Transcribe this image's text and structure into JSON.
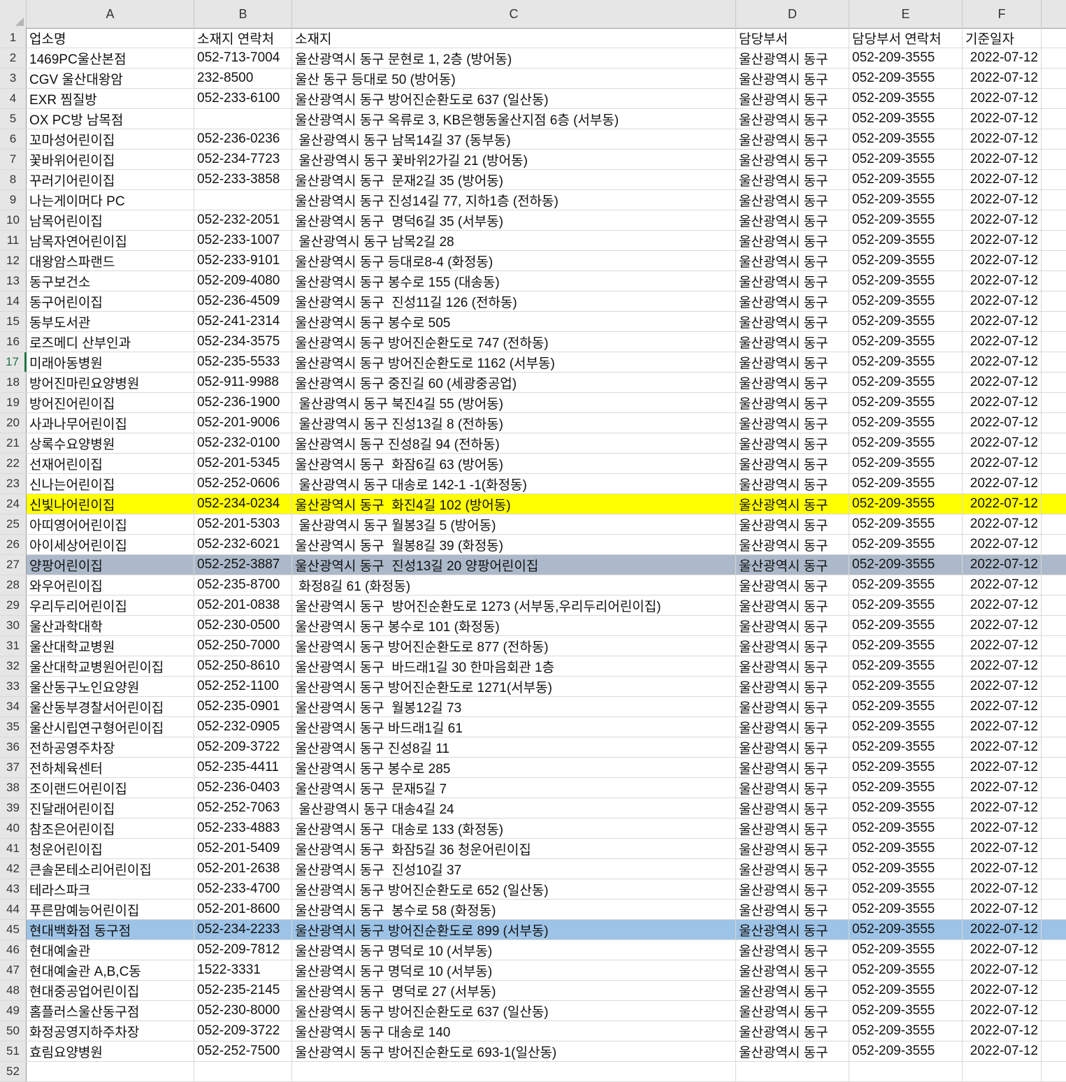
{
  "columns": [
    "A",
    "B",
    "C",
    "D",
    "E",
    "F"
  ],
  "header": {
    "a": "업소명",
    "b": "소재지 연락처",
    "c": "소재지",
    "d": "담당부서",
    "e": "담당부서 연락처",
    "f": "기준일자"
  },
  "rows": [
    {
      "n": "2",
      "a": "1469PC울산본점",
      "b": "052-713-7004",
      "c": "울산광역시 동구 문현로 1, 2층 (방어동)",
      "d": "울산광역시 동구",
      "e": "052-209-3555",
      "f": "2022-07-12"
    },
    {
      "n": "3",
      "a": "CGV 울산대왕암",
      "b": "232-8500",
      "c": "울산 동구 등대로 50 (방어동)",
      "d": "울산광역시 동구",
      "e": "052-209-3555",
      "f": "2022-07-12"
    },
    {
      "n": "4",
      "a": "EXR 찜질방",
      "b": "052-233-6100",
      "c": "울산광역시 동구 방어진순환도로 637 (일산동)",
      "d": "울산광역시 동구",
      "e": "052-209-3555",
      "f": "2022-07-12"
    },
    {
      "n": "5",
      "a": "OX PC방 남목점",
      "b": "",
      "c": "울산광역시 동구 옥류로 3, KB은행동울산지점 6층 (서부동)",
      "d": "울산광역시 동구",
      "e": "052-209-3555",
      "f": "2022-07-12"
    },
    {
      "n": "6",
      "a": "꼬마성어린이집",
      "b": "052-236-0236",
      "c": " 울산광역시 동구 남목14길 37 (동부동)",
      "d": "울산광역시 동구",
      "e": "052-209-3555",
      "f": "2022-07-12"
    },
    {
      "n": "7",
      "a": "꽃바위어린이집",
      "b": "052-234-7723",
      "c": " 울산광역시 동구 꽃바위2가길 21 (방어동)",
      "d": "울산광역시 동구",
      "e": "052-209-3555",
      "f": "2022-07-12"
    },
    {
      "n": "8",
      "a": "꾸러기어린이집",
      "b": "052-233-3858",
      "c": "울산광역시 동구  문재2길 35 (방어동)",
      "d": "울산광역시 동구",
      "e": "052-209-3555",
      "f": "2022-07-12"
    },
    {
      "n": "9",
      "a": "나는게이머다 PC",
      "b": "",
      "c": "울산광역시 동구 진성14길 77, 지하1층 (전하동)",
      "d": "울산광역시 동구",
      "e": "052-209-3555",
      "f": "2022-07-12"
    },
    {
      "n": "10",
      "a": "남목어린이집",
      "b": "052-232-2051",
      "c": "울산광역시 동구  명덕6길 35 (서부동)",
      "d": "울산광역시 동구",
      "e": "052-209-3555",
      "f": "2022-07-12"
    },
    {
      "n": "11",
      "a": "남목자연어린이집",
      "b": "052-233-1007",
      "c": " 울산광역시 동구 남목2길 28",
      "d": "울산광역시 동구",
      "e": "052-209-3555",
      "f": "2022-07-12"
    },
    {
      "n": "12",
      "a": "대왕암스파랜드",
      "b": "052-233-9101",
      "c": "울산광역시 동구 등대로8-4 (화정동)",
      "d": "울산광역시 동구",
      "e": "052-209-3555",
      "f": "2022-07-12"
    },
    {
      "n": "13",
      "a": "동구보건소",
      "b": "052-209-4080",
      "c": "울산광역시 동구 봉수로 155 (대송동)",
      "d": "울산광역시 동구",
      "e": "052-209-3555",
      "f": "2022-07-12"
    },
    {
      "n": "14",
      "a": "동구어린이집",
      "b": "052-236-4509",
      "c": "울산광역시 동구  진성11길 126 (전하동)",
      "d": "울산광역시 동구",
      "e": "052-209-3555",
      "f": "2022-07-12"
    },
    {
      "n": "15",
      "a": "동부도서관",
      "b": "052-241-2314",
      "c": "울산광역시 동구 봉수로 505",
      "d": "울산광역시 동구",
      "e": "052-209-3555",
      "f": "2022-07-12"
    },
    {
      "n": "16",
      "a": "로즈메디 산부인과",
      "b": "052-234-3575",
      "c": "울산광역시 동구 방어진순환도로 747 (전하동)",
      "d": "울산광역시 동구",
      "e": "052-209-3555",
      "f": "2022-07-12"
    },
    {
      "n": "17",
      "a": "미래아동병원",
      "b": "052-235-5533",
      "c": "울산광역시 동구 방어진순환도로 1162 (서부동)",
      "d": "울산광역시 동구",
      "e": "052-209-3555",
      "f": "2022-07-12"
    },
    {
      "n": "18",
      "a": "방어진마린요양병원",
      "b": "052-911-9988",
      "c": "울산광역시 동구 중진길 60 (세광중공업)",
      "d": "울산광역시 동구",
      "e": "052-209-3555",
      "f": "2022-07-12"
    },
    {
      "n": "19",
      "a": "방어진어린이집",
      "b": "052-236-1900",
      "c": " 울산광역시 동구 북진4길 55 (방어동)",
      "d": "울산광역시 동구",
      "e": "052-209-3555",
      "f": "2022-07-12"
    },
    {
      "n": "20",
      "a": "사과나무어린이집",
      "b": "052-201-9006",
      "c": " 울산광역시 동구 진성13길 8 (전하동)",
      "d": "울산광역시 동구",
      "e": "052-209-3555",
      "f": "2022-07-12"
    },
    {
      "n": "21",
      "a": "상록수요양병원",
      "b": "052-232-0100",
      "c": "울산광역시 동구 진성8길 94 (전하동)",
      "d": "울산광역시 동구",
      "e": "052-209-3555",
      "f": "2022-07-12"
    },
    {
      "n": "22",
      "a": "선재어린이집",
      "b": "052-201-5345",
      "c": "울산광역시 동구  화잠6길 63 (방어동)",
      "d": "울산광역시 동구",
      "e": "052-209-3555",
      "f": "2022-07-12"
    },
    {
      "n": "23",
      "a": "신나는어린이집",
      "b": "052-252-0606",
      "c": " 울산광역시 동구 대송로 142-1 -1(화정동)",
      "d": "울산광역시 동구",
      "e": "052-209-3555",
      "f": "2022-07-12"
    },
    {
      "n": "24",
      "a": "신빛나어린이집",
      "b": "052-234-0234",
      "c": "울산광역시 동구  화진4길 102 (방어동)",
      "d": "울산광역시 동구",
      "e": "052-209-3555",
      "f": "2022-07-12",
      "hl": "hl-yellow"
    },
    {
      "n": "25",
      "a": "아띠영어어린이집",
      "b": "052-201-5303",
      "c": " 울산광역시 동구 월봉3길 5 (방어동)",
      "d": "울산광역시 동구",
      "e": "052-209-3555",
      "f": "2022-07-12"
    },
    {
      "n": "26",
      "a": "아이세상어린이집",
      "b": "052-232-6021",
      "c": "울산광역시 동구  월봉8길 39 (화정동)",
      "d": "울산광역시 동구",
      "e": "052-209-3555",
      "f": "2022-07-12"
    },
    {
      "n": "27",
      "a": "양팡어린이집",
      "b": "052-252-3887",
      "c": "울산광역시 동구  진성13길 20 양팡어린이집",
      "d": "울산광역시 동구",
      "e": "052-209-3555",
      "f": "2022-07-12",
      "hl": "hl-gray"
    },
    {
      "n": "28",
      "a": "와우어린이집",
      "b": "052-235-8700",
      "c": " 화정8길 61 (화정동)",
      "d": "울산광역시 동구",
      "e": "052-209-3555",
      "f": "2022-07-12"
    },
    {
      "n": "29",
      "a": "우리두리어린이집",
      "b": "052-201-0838",
      "c": "울산광역시 동구  방어진순환도로 1273 (서부동,우리두리어린이집)",
      "d": "울산광역시 동구",
      "e": "052-209-3555",
      "f": "2022-07-12"
    },
    {
      "n": "30",
      "a": "울산과학대학",
      "b": "052-230-0500",
      "c": "울산광역시 동구 봉수로 101 (화정동)",
      "d": "울산광역시 동구",
      "e": "052-209-3555",
      "f": "2022-07-12"
    },
    {
      "n": "31",
      "a": "울산대학교병원",
      "b": "052-250-7000",
      "c": "울산광역시 동구 방어진순환도로 877 (전하동)",
      "d": "울산광역시 동구",
      "e": "052-209-3555",
      "f": "2022-07-12"
    },
    {
      "n": "32",
      "a": "울산대학교병원어린이집",
      "b": "052-250-8610",
      "c": "울산광역시 동구  바드래1길 30 한마음회관 1층",
      "d": "울산광역시 동구",
      "e": "052-209-3555",
      "f": "2022-07-12"
    },
    {
      "n": "33",
      "a": "울산동구노인요양원",
      "b": "052-252-1100",
      "c": "울산광역시 동구 방어진순환도로 1271(서부동)",
      "d": "울산광역시 동구",
      "e": "052-209-3555",
      "f": "2022-07-12"
    },
    {
      "n": "34",
      "a": "울산동부경찰서어린이집",
      "b": "052-235-0901",
      "c": "울산광역시 동구  월봉12길 73",
      "d": "울산광역시 동구",
      "e": "052-209-3555",
      "f": "2022-07-12"
    },
    {
      "n": "35",
      "a": "울산시립연구형어린이집",
      "b": "052-232-0905",
      "c": "울산광역시 동구 바드래1길 61",
      "d": "울산광역시 동구",
      "e": "052-209-3555",
      "f": "2022-07-12"
    },
    {
      "n": "36",
      "a": "전하공영주차장",
      "b": "052-209-3722",
      "c": "울산광역시 동구 진성8길 11",
      "d": "울산광역시 동구",
      "e": "052-209-3555",
      "f": "2022-07-12"
    },
    {
      "n": "37",
      "a": "전하체육센터",
      "b": "052-235-4411",
      "c": "울산광역시 동구 봉수로 285",
      "d": "울산광역시 동구",
      "e": "052-209-3555",
      "f": "2022-07-12"
    },
    {
      "n": "38",
      "a": "조이랜드어린이집",
      "b": "052-236-0403",
      "c": "울산광역시 동구  문재5길 7",
      "d": "울산광역시 동구",
      "e": "052-209-3555",
      "f": "2022-07-12"
    },
    {
      "n": "39",
      "a": "진달래어린이집",
      "b": "052-252-7063",
      "c": " 울산광역시 동구 대송4길 24",
      "d": "울산광역시 동구",
      "e": "052-209-3555",
      "f": "2022-07-12"
    },
    {
      "n": "40",
      "a": "참조은어린이집",
      "b": "052-233-4883",
      "c": "울산광역시 동구  대송로 133 (화정동)",
      "d": "울산광역시 동구",
      "e": "052-209-3555",
      "f": "2022-07-12"
    },
    {
      "n": "41",
      "a": "청운어린이집",
      "b": "052-201-5409",
      "c": "울산광역시 동구  화잠5길 36 청운어린이집",
      "d": "울산광역시 동구",
      "e": "052-209-3555",
      "f": "2022-07-12"
    },
    {
      "n": "42",
      "a": "큰솔몬테소리어린이집",
      "b": "052-201-2638",
      "c": "울산광역시 동구  진성10길 37",
      "d": "울산광역시 동구",
      "e": "052-209-3555",
      "f": "2022-07-12"
    },
    {
      "n": "43",
      "a": "테라스파크",
      "b": "052-233-4700",
      "c": "울산광역시 동구 방어진순환도로 652 (일산동)",
      "d": "울산광역시 동구",
      "e": "052-209-3555",
      "f": "2022-07-12"
    },
    {
      "n": "44",
      "a": "푸른맘예능어린이집",
      "b": "052-201-8600",
      "c": "울산광역시 동구  봉수로 58 (화정동)",
      "d": "울산광역시 동구",
      "e": "052-209-3555",
      "f": "2022-07-12"
    },
    {
      "n": "45",
      "a": "현대백화점 동구점",
      "b": "052-234-2233",
      "c": "울산광역시 동구 방어진순환도로 899 (서부동)",
      "d": "울산광역시 동구",
      "e": "052-209-3555",
      "f": "2022-07-12",
      "hl": "hl-blue"
    },
    {
      "n": "46",
      "a": "현대예술관",
      "b": "052-209-7812",
      "c": "울산광역시 동구 명덕로 10 (서부동)",
      "d": "울산광역시 동구",
      "e": "052-209-3555",
      "f": "2022-07-12"
    },
    {
      "n": "47",
      "a": "현대예술관 A,B,C동",
      "b": "1522-3331",
      "c": "울산광역시 동구 명덕로 10 (서부동)",
      "d": "울산광역시 동구",
      "e": "052-209-3555",
      "f": "2022-07-12"
    },
    {
      "n": "48",
      "a": "현대중공업어린이집",
      "b": "052-235-2145",
      "c": "울산광역시 동구  명덕로 27 (서부동)",
      "d": "울산광역시 동구",
      "e": "052-209-3555",
      "f": "2022-07-12"
    },
    {
      "n": "49",
      "a": "홈플러스울산동구점",
      "b": "052-230-8000",
      "c": "울산광역시 동구 방어진순환도로 637 (일산동)",
      "d": "울산광역시 동구",
      "e": "052-209-3555",
      "f": "2022-07-12"
    },
    {
      "n": "50",
      "a": "화정공영지하주차장",
      "b": "052-209-3722",
      "c": "울산광역시 동구 대송로 140",
      "d": "울산광역시 동구",
      "e": "052-209-3555",
      "f": "2022-07-12"
    },
    {
      "n": "51",
      "a": "효림요양병원",
      "b": "052-252-7500",
      "c": "울산광역시 동구 방어진순환도로 693-1(일산동)",
      "d": "울산광역시 동구",
      "e": "052-209-3555",
      "f": "2022-07-12"
    }
  ],
  "extra_row": "52",
  "active_row": "17"
}
